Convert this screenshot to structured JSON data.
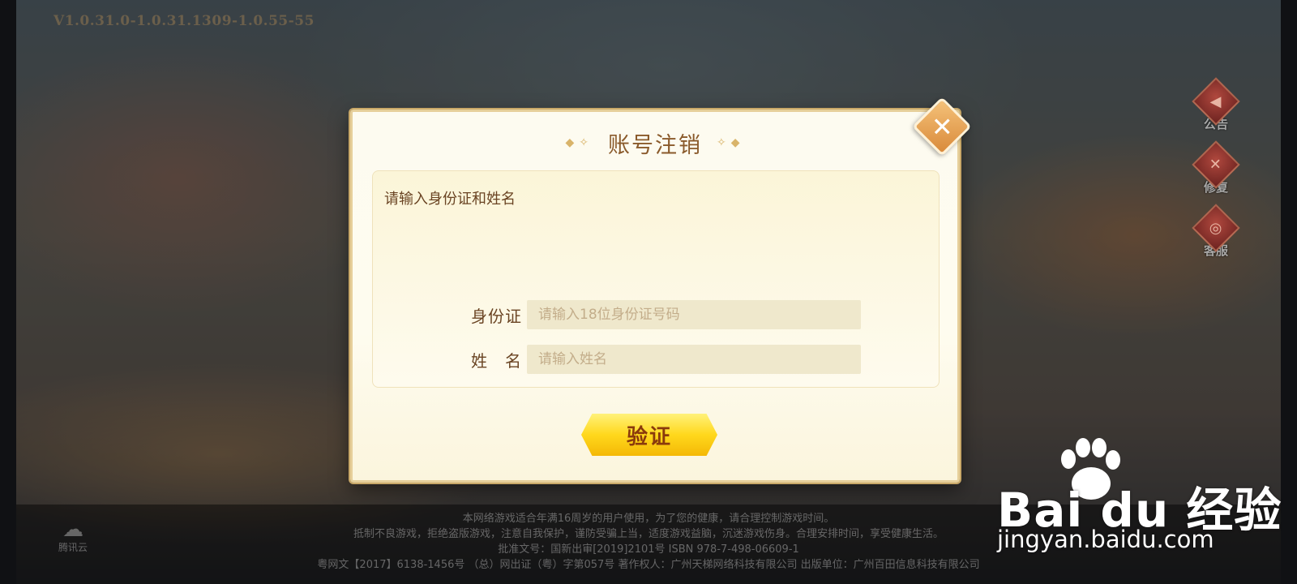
{
  "version": "V1.0.31.0-1.0.31.1309-1.0.55-55",
  "side_buttons": [
    {
      "label": "公告",
      "icon": "announcement-icon"
    },
    {
      "label": "修复",
      "icon": "repair-icon"
    },
    {
      "label": "客服",
      "icon": "customer-service-icon"
    }
  ],
  "dialog": {
    "title": "账号注销",
    "prompt": "请输入身份证和姓名",
    "id_label": "身份证",
    "id_placeholder": "请输入18位身份证号码",
    "name_label": "姓　名",
    "name_placeholder": "请输入姓名",
    "verify_label": "验证",
    "close_icon": "close-icon"
  },
  "footer": {
    "line1": "本网络游戏适合年满16周岁的用户使用，为了您的健康，请合理控制游戏时间。",
    "line2": "抵制不良游戏，拒绝盗版游戏，注意自我保护，谨防受骗上当，适度游戏益脑，沉迷游戏伤身。合理安排时间，享受健康生活。",
    "line3": "批准文号：国新出审[2019]2101号  ISBN  978-7-498-06609-1",
    "line4": "粤网文【2017】6138-1456号  （总）网出证（粤）字第057号  著作权人：广州天梯网络科技有限公司  出版单位：广州百田信息科技有限公司",
    "cloud_logo": "腾讯云"
  },
  "watermark": {
    "brand": "Bai du 经验",
    "url": "jingyan.baidu.com"
  }
}
